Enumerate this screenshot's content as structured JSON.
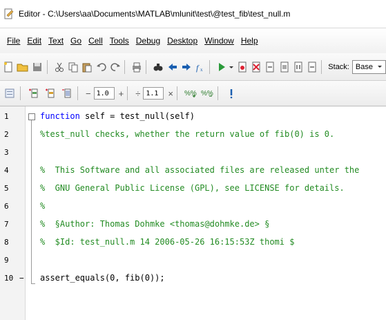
{
  "window": {
    "title": "Editor - C:\\Users\\aa\\Documents\\MATLAB\\mlunit\\test\\@test_fib\\test_null.m"
  },
  "menubar": {
    "items": [
      "File",
      "Edit",
      "Text",
      "Go",
      "Cell",
      "Tools",
      "Debug",
      "Desktop",
      "Window",
      "Help"
    ]
  },
  "toolbar": {
    "stack_label": "Stack:",
    "stack_value": "Base"
  },
  "cell_toolbar": {
    "minus": "−",
    "value1": "1.0",
    "plus": "+",
    "divide": "÷",
    "value2": "1.1",
    "times": "×"
  },
  "editor": {
    "lines": [
      {
        "num": "1",
        "text": "function self = test_null(self)"
      },
      {
        "num": "2",
        "text": "%test_null checks, whether the return value of fib(0) is 0."
      },
      {
        "num": "3",
        "text": ""
      },
      {
        "num": "4",
        "text": "%  This Software and all associated files are released unter the"
      },
      {
        "num": "5",
        "text": "%  GNU General Public License (GPL), see LICENSE for details."
      },
      {
        "num": "6",
        "text": "%"
      },
      {
        "num": "7",
        "text": "%  §Author: Thomas Dohmke <thomas@dohmke.de> §"
      },
      {
        "num": "8",
        "text": "%  $Id: test_null.m 14 2006-05-26 16:15:53Z thomi $"
      },
      {
        "num": "9",
        "text": ""
      },
      {
        "num": "10",
        "text": "assert_equals(0, fib(0));"
      }
    ],
    "line10_marker": "−"
  },
  "colors": {
    "keyword": "#0000ff",
    "comment": "#228b22",
    "text": "#000000"
  }
}
